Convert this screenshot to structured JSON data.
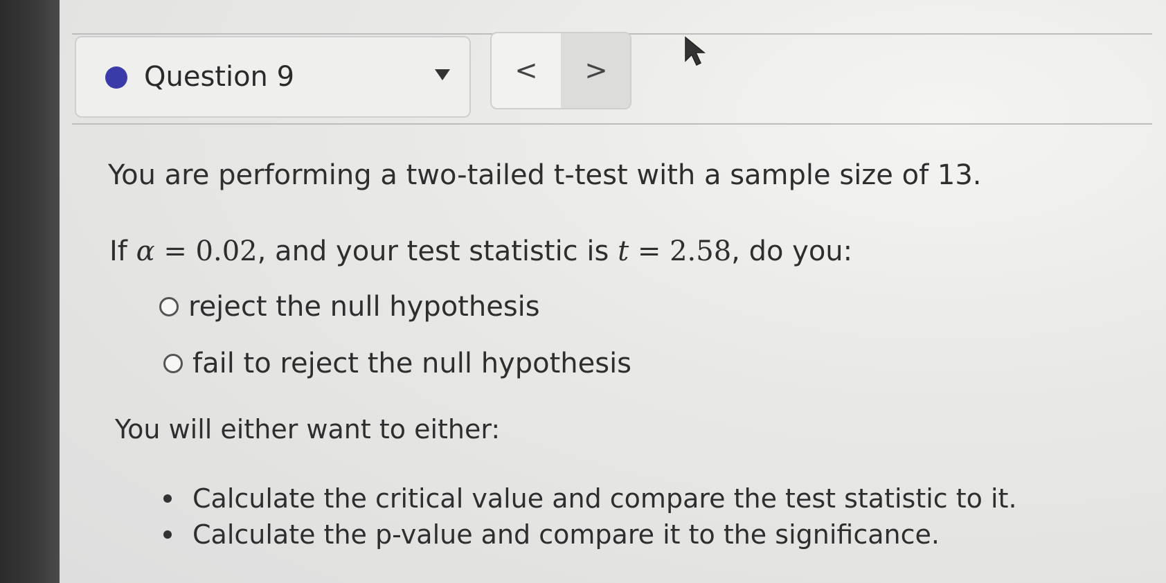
{
  "question_selector": {
    "label": "Question 9",
    "status_color": "#3a3aa8"
  },
  "nav": {
    "prev_glyph": "<",
    "next_glyph": ">"
  },
  "question": {
    "intro": "You are performing a two-tailed t-test with a sample size of 13.",
    "prompt_prefix": "If ",
    "alpha_symbol": "α",
    "alpha_value": " = 0.02",
    "prompt_middle": ", and your test statistic is ",
    "t_symbol": "t",
    "t_value": " = 2.58",
    "prompt_suffix": ", do you:",
    "options": [
      "reject the null hypothesis",
      "fail to reject the null hypothesis"
    ]
  },
  "hint": {
    "intro": "You will either want to either:",
    "items": [
      "Calculate the critical value and compare the test statistic to it.",
      "Calculate the p-value and compare it to the significance."
    ]
  }
}
